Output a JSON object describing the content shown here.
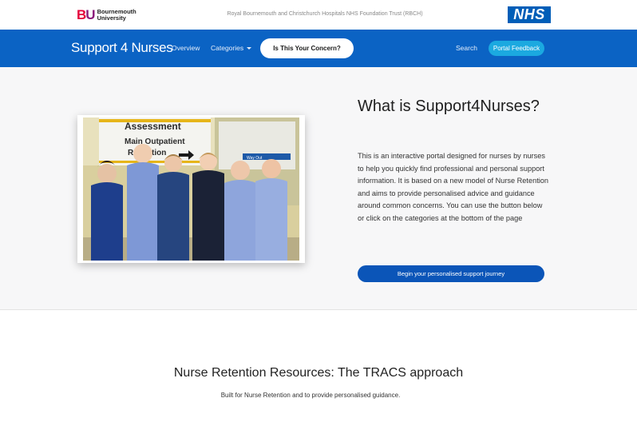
{
  "topbar": {
    "university_logo_text": "Bournemouth University",
    "trust_name": "Royal Bournemouth and Christchurch Hospitals NHS Foundation Trust (RBCH)",
    "nhs_logo_text": "NHS"
  },
  "navbar": {
    "brand": "Support 4 Nurses",
    "overview": "Overview",
    "categories": "Categories",
    "concern_button": "Is This Your Concern?",
    "search": "Search",
    "feedback_button": "Portal Feedback"
  },
  "hero": {
    "title": "What is Support4Nurses?",
    "description": "This is an interactive portal designed for nurses by nurses to help you quickly find professional and personal support information. It is based on a new model of Nurse Retention and aims to provide personalised advice and guidance around common concerns. You can use the button below or click on the categories at the bottom of the page",
    "journey_button": "Begin your personalised support journey",
    "photo": {
      "sign_line1": "Assessment",
      "sign_line2": "Main Outpatient",
      "sign_line3": "Reception",
      "sign_right": "Way Out"
    }
  },
  "resources": {
    "title": "Nurse Retention Resources: The TRACS approach",
    "subtitle": "Built for Nurse Retention and to provide personalised guidance."
  },
  "colors": {
    "nav_blue": "#0b63c4",
    "nhs_blue": "#005eb8",
    "feedback_cyan": "#1ba9e0",
    "button_blue": "#0b55b8"
  }
}
